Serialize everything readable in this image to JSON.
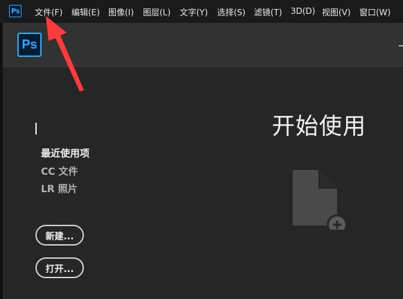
{
  "app": {
    "logo_text": "Ps"
  },
  "menu": [
    {
      "label": "文件(F)"
    },
    {
      "label": "编辑(E)"
    },
    {
      "label": "图像(I)"
    },
    {
      "label": "图层(L)"
    },
    {
      "label": "文字(Y)"
    },
    {
      "label": "选择(S)"
    },
    {
      "label": "滤镜(T)"
    },
    {
      "label": "3D(D)"
    },
    {
      "label": "视图(V)"
    },
    {
      "label": "窗口(W)"
    }
  ],
  "home": {
    "title": "开始使用",
    "nav": [
      {
        "label": "最近使用项",
        "active": true
      },
      {
        "label": "CC 文件",
        "active": false
      },
      {
        "label": "LR 照片",
        "active": false
      }
    ],
    "buttons": {
      "new_label": "新建...",
      "open_label": "打开..."
    }
  },
  "colors": {
    "accent": "#31a8ff",
    "annotation_arrow": "#ff3b3b",
    "panel": "#262626",
    "header": "#323232"
  }
}
